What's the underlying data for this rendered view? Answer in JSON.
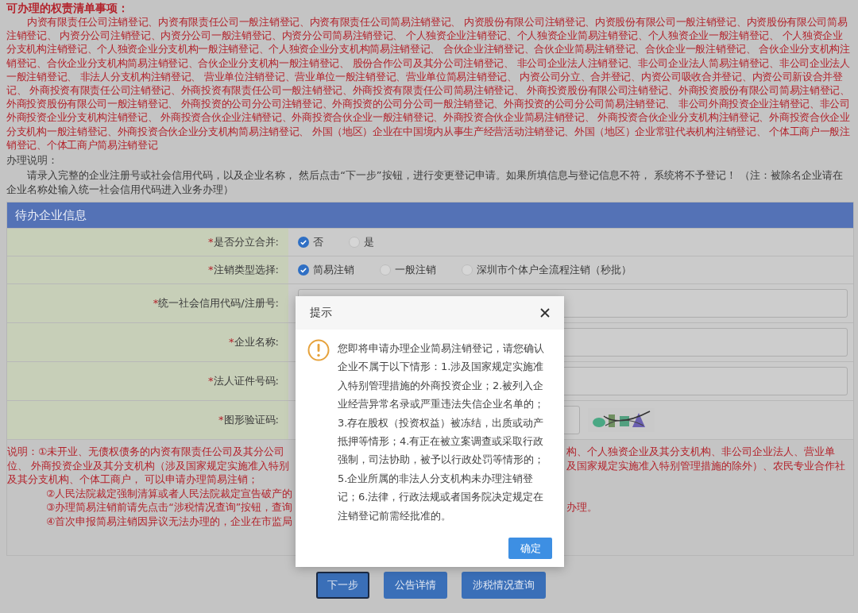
{
  "title": "可办理的权责清单事项：",
  "items_text": "内资有限责任公司注销登记、内资有限责任公司一般注销登记、内资有限责任公司简易注销登记、 内资股份有限公司注销登记、内资股份有限公司一般注销登记、内资股份有限公司简易注销登记、 内资分公司注销登记、内资分公司一般注销登记、内资分公司简易注销登记、 个人独资企业注销登记、个人独资企业简易注销登记、个人独资企业一般注销登记、 个人独资企业分支机构注销登记、个人独资企业分支机构一般注销登记、个人独资企业分支机构简易注销登记、 合伙企业注销登记、合伙企业简易注销登记、合伙企业一般注销登记、 合伙企业分支机构注销登记、合伙企业分支机构简易注销登记、合伙企业分支机构一般注销登记、 股份合作公司及其分公司注销登记、 非公司企业法人注销登记、非公司企业法人简易注销登记、非公司企业法人一般注销登记、 非法人分支机构注销登记、 营业单位注销登记、营业单位一般注销登记、营业单位简易注销登记、 内资公司分立、合并登记、内资公司吸收合并登记、内资公司新设合并登记、 外商投资有限责任公司注销登记、外商投资有限责任公司一般注销登记、外商投资有限责任公司简易注销登记、 外商投资股份有限公司注销登记、外商投资股份有限公司简易注销登记、外商投资股份有限公司一般注销登记、 外商投资的公司分公司注销登记、外商投资的公司分公司一般注销登记、外商投资的公司分公司简易注销登记、 非公司外商投资企业注销登记、非公司外商投资企业分支机构注销登记、 外商投资合伙企业注销登记、外商投资合伙企业一般注销登记、外商投资合伙企业简易注销登记、 外商投资合伙企业分支机构注销登记、外商投资合伙企业分支机构一般注销登记、外商投资合伙企业分支机构简易注销登记、 外国（地区）企业在中国境内从事生产经营活动注销登记、外国（地区）企业常驻代表机构注销登记、 个体工商户一般注销登记、个体工商户简易注销登记",
  "instructions": {
    "heading": "办理说明：",
    "text": "请录入完整的企业注册号或社会信用代码，以及企业名称， 然后点击“下一步”按钮，进行变更登记申请。如果所填信息与登记信息不符， 系统将不予登记！ （注：被除名企业请在企业名称处输入统一社会信用代码进入业务办理）"
  },
  "panel": {
    "title": "待办企业信息"
  },
  "form_rows": [
    {
      "required_mark": "*",
      "label": "是否分立合并:",
      "kind": "radio",
      "options": [
        {
          "label": "否",
          "selected": true
        },
        {
          "label": "是",
          "selected": false
        }
      ]
    },
    {
      "required_mark": "*",
      "label": "注销类型选择:",
      "kind": "radio",
      "options": [
        {
          "label": "简易注销",
          "selected": true
        },
        {
          "label": "一般注销",
          "selected": false
        },
        {
          "label": "深圳市个体户全流程注销（秒批）",
          "selected": false
        }
      ]
    },
    {
      "required_mark": "*",
      "label": "统一社会信用代码/注册号:",
      "kind": "input"
    },
    {
      "required_mark": "*",
      "label": "企业名称:",
      "kind": "input"
    },
    {
      "required_mark": "*",
      "label": "法人证件号码:",
      "kind": "input"
    },
    {
      "required_mark": "*",
      "label": "图形验证码:",
      "kind": "captcha"
    }
  ],
  "notes": [
    {
      "lines": [
        {
          "left": "说明：①未开业、无债权债务的内资有限责任公司及其分公司",
          "right": "构、个人独资企业及其分支机构、非公司企业法人、营业单"
        },
        {
          "left": "位、 外商投资企业及其分支机构（涉及国家规定实施准入特别",
          "right": "及国家规定实施准入特别管理措施的除外）、农民专业合作社"
        },
        {
          "left": "及其分支机构、个体工商户， 可以申请办理简易注销；"
        }
      ],
      "children": [
        {
          "lines": [
            {
              "left": "②人民法院裁定强制清算或者人民法院裁定宣告破产的"
            }
          ]
        },
        {
          "lines": [
            {
              "left": "③办理简易注销前请先点击“涉税情况查询”按钮，查询",
              "right": "办理。"
            }
          ]
        },
        {
          "lines": [
            {
              "left": "④首次申报简易注销因异议无法办理的，企业在市监局"
            }
          ]
        }
      ]
    }
  ],
  "buttons": [
    {
      "label": "下一步",
      "focused": true
    },
    {
      "label": "公告详情",
      "focused": false
    },
    {
      "label": "涉税情况查询",
      "focused": false
    }
  ],
  "dialog": {
    "title": "提示",
    "message": "您即将申请办理企业简易注销登记，请您确认企业不属于以下情形：1.涉及国家规定实施准入特别管理措施的外商投资企业；2.被列入企业经营异常名录或严重违法失信企业名单的；3.存在股权（投资权益）被冻结，出质或动产抵押等情形；4.有正在被立案调查或采取行政强制，司法协助，被予以行政处罚等情形的；5.企业所属的非法人分支机构未办理注销登记；6.法律，行政法规或者国务院决定规定在注销登记前需经批准的。",
    "confirm": "确定"
  }
}
